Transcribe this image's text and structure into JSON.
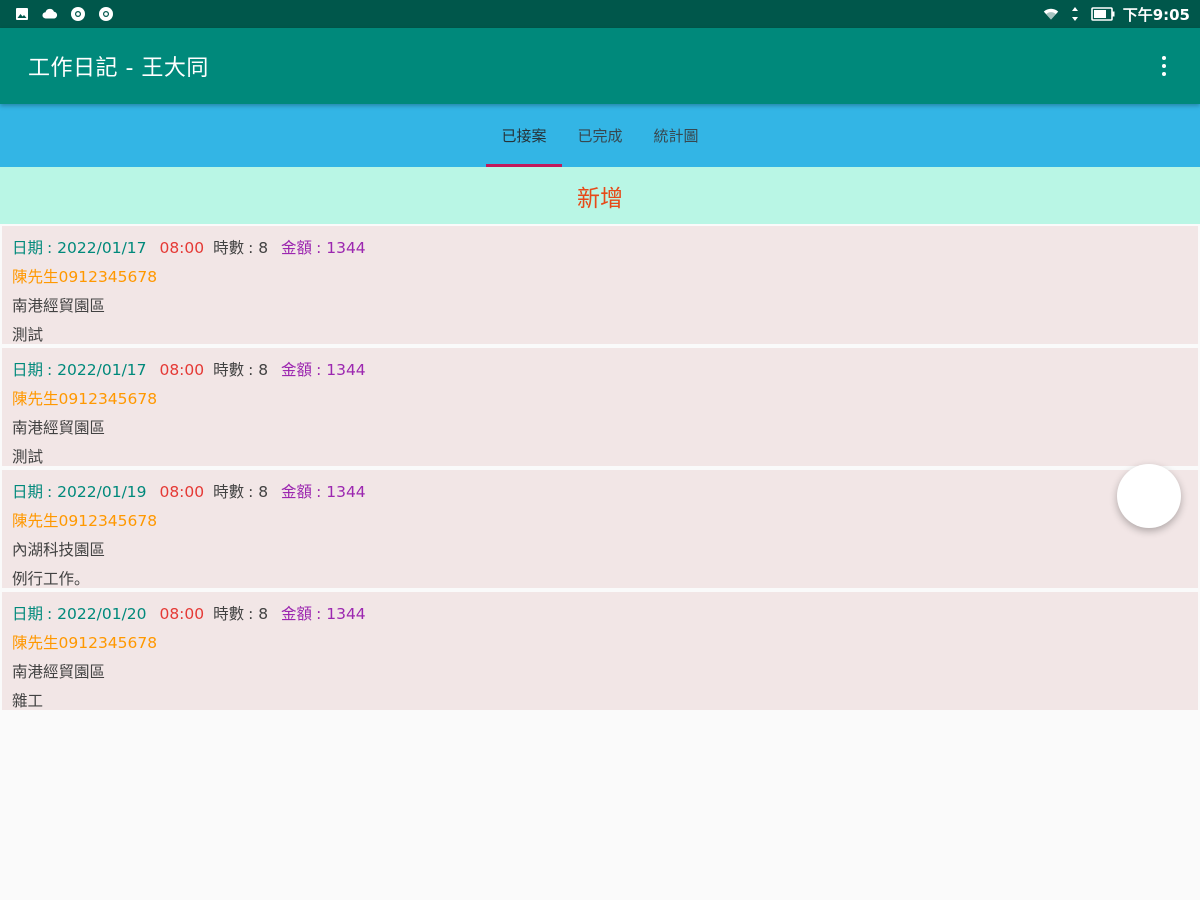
{
  "status_bar": {
    "time": "下午9:05",
    "left_icons": [
      "image-icon",
      "cloud-icon",
      "chrome-icon",
      "chrome-icon"
    ],
    "right_icons": [
      "wifi-icon",
      "data-arrows-icon",
      "battery-icon"
    ]
  },
  "app_bar": {
    "title": "工作日記 - 王大同",
    "menu_icon": "more-vert-icon"
  },
  "tabs": [
    {
      "label": "已接案",
      "active": true
    },
    {
      "label": "已完成",
      "active": false
    },
    {
      "label": "統計圖",
      "active": false
    }
  ],
  "add_button": {
    "label": "新增"
  },
  "labels": {
    "date": "日期",
    "hours": "時數",
    "amount": "金額"
  },
  "records": [
    {
      "date": "2022/01/17",
      "time": "08:00",
      "hours": "8",
      "amount": "1344",
      "contact": "陳先生0912345678",
      "place": "南港經貿園區",
      "note": "測試"
    },
    {
      "date": "2022/01/17",
      "time": "08:00",
      "hours": "8",
      "amount": "1344",
      "contact": "陳先生0912345678",
      "place": "南港經貿園區",
      "note": "測試"
    },
    {
      "date": "2022/01/19",
      "time": "08:00",
      "hours": "8",
      "amount": "1344",
      "contact": "陳先生0912345678",
      "place": "內湖科技園區",
      "note": "例行工作。"
    },
    {
      "date": "2022/01/20",
      "time": "08:00",
      "hours": "8",
      "amount": "1344",
      "contact": "陳先生0912345678",
      "place": "南港經貿園區",
      "note": "雜工"
    }
  ],
  "colors": {
    "status_bar": "#00574b",
    "app_bar": "#00897b",
    "tab_bar": "#33b5e5",
    "tab_indicator": "#c2185b",
    "add_bar": "#b9f6e5",
    "add_text": "#e64a19",
    "card_bg": "#f2e6e6",
    "date_text": "#00897b",
    "time_text": "#e53935",
    "amount_text": "#9c27b0",
    "contact_text": "#ff9800"
  }
}
